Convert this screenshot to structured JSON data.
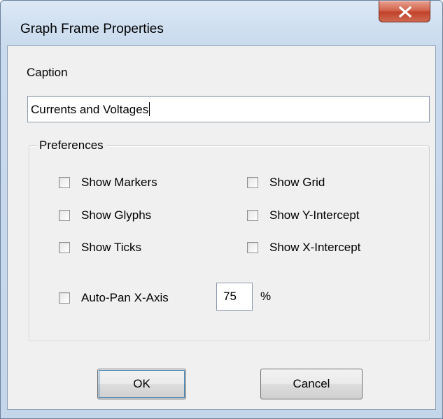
{
  "window": {
    "title": "Graph Frame Properties"
  },
  "caption": {
    "label": "Caption",
    "value": "Currents and Voltages"
  },
  "preferences": {
    "legend": "Preferences",
    "options": {
      "show_markers": {
        "label": "Show Markers",
        "checked": false
      },
      "show_glyphs": {
        "label": "Show Glyphs",
        "checked": false
      },
      "show_ticks": {
        "label": "Show Ticks",
        "checked": false
      },
      "show_grid": {
        "label": "Show Grid",
        "checked": false
      },
      "show_y_intercept": {
        "label": "Show Y-Intercept",
        "checked": false
      },
      "show_x_intercept": {
        "label": "Show X-Intercept",
        "checked": false
      },
      "auto_pan_x_axis": {
        "label": "Auto-Pan X-Axis",
        "checked": false
      }
    },
    "auto_pan_percent": "75",
    "percent_sign": "%"
  },
  "buttons": {
    "ok": "OK",
    "cancel": "Cancel"
  }
}
